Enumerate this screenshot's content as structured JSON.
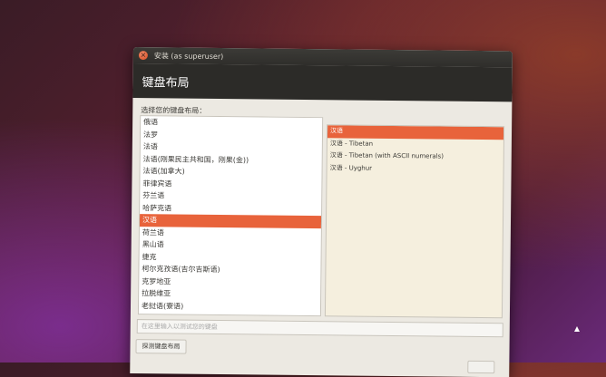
{
  "window": {
    "title": "安装 (as superuser)",
    "close_icon": "×"
  },
  "header": {
    "title": "键盘布局"
  },
  "prompt": {
    "label": "选择您的键盘布局："
  },
  "layouts": {
    "items": [
      {
        "label": "俄语",
        "selected": false
      },
      {
        "label": "法罗",
        "selected": false
      },
      {
        "label": "法语",
        "selected": false
      },
      {
        "label": "法语(刚果民主共和国，刚果(金))",
        "selected": false
      },
      {
        "label": "法语(加拿大)",
        "selected": false
      },
      {
        "label": "菲律宾语",
        "selected": false
      },
      {
        "label": "芬兰语",
        "selected": false
      },
      {
        "label": "哈萨克语",
        "selected": false
      },
      {
        "label": "汉语",
        "selected": true
      },
      {
        "label": "荷兰语",
        "selected": false
      },
      {
        "label": "黑山语",
        "selected": false
      },
      {
        "label": "捷克",
        "selected": false
      },
      {
        "label": "柯尔克孜语(吉尔吉斯语)",
        "selected": false
      },
      {
        "label": "克罗地亚",
        "selected": false
      },
      {
        "label": "拉脱维亚",
        "selected": false
      },
      {
        "label": "老挝语(寮语)",
        "selected": false
      }
    ]
  },
  "variants": {
    "items": [
      {
        "label": "汉语",
        "selected": true
      },
      {
        "label": "汉语 - Tibetan",
        "selected": false
      },
      {
        "label": "汉语 - Tibetan (with ASCII numerals)",
        "selected": false
      },
      {
        "label": "汉语 - Uyghur",
        "selected": false
      }
    ]
  },
  "search": {
    "placeholder": "在这里输入以测试您的键盘"
  },
  "detect": {
    "label": "探测键盘布局"
  },
  "colors": {
    "accent": "#e8633b",
    "header_bg": "#2c2b28"
  }
}
